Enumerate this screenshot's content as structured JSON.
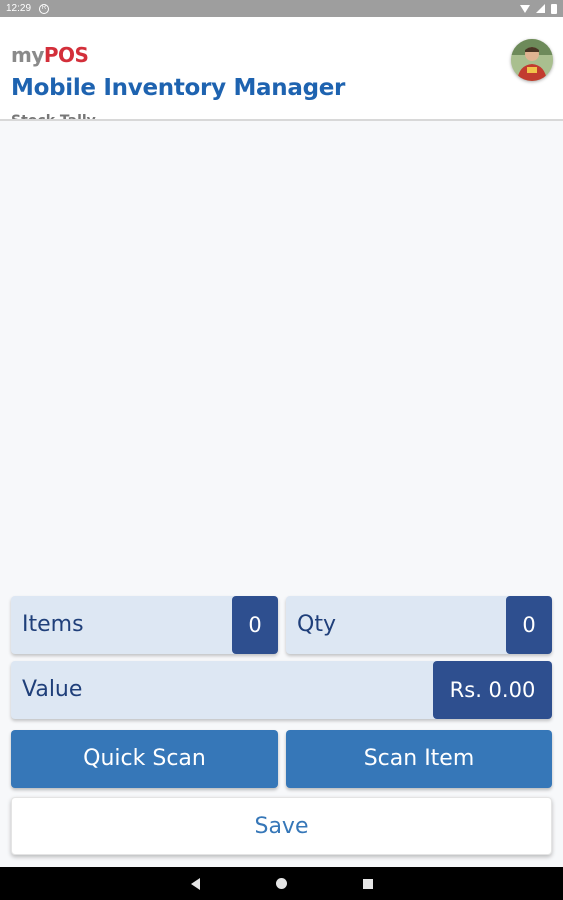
{
  "status_bar": {
    "time": "12:29"
  },
  "header": {
    "logo_my": "my",
    "logo_pos": "POS",
    "title": "Mobile Inventory Manager",
    "subtitle_fragment": "Stock Tally"
  },
  "summary": {
    "items_label": "Items",
    "items_value": "0",
    "qty_label": "Qty",
    "qty_value": "0",
    "value_label": "Value",
    "value_amount": "Rs. 0.00"
  },
  "actions": {
    "quick_scan": "Quick Scan",
    "scan_item": "Scan Item",
    "save": "Save"
  },
  "colors": {
    "brand_blue": "#1e63b0",
    "button_blue": "#3677b8",
    "badge_navy": "#2e4f8f",
    "logo_red": "#d32f3a",
    "stat_bg": "#dde7f3"
  },
  "icons": {
    "avatar": "user-avatar",
    "back": "back-icon",
    "home": "home-icon",
    "recent": "recent-apps-icon"
  }
}
